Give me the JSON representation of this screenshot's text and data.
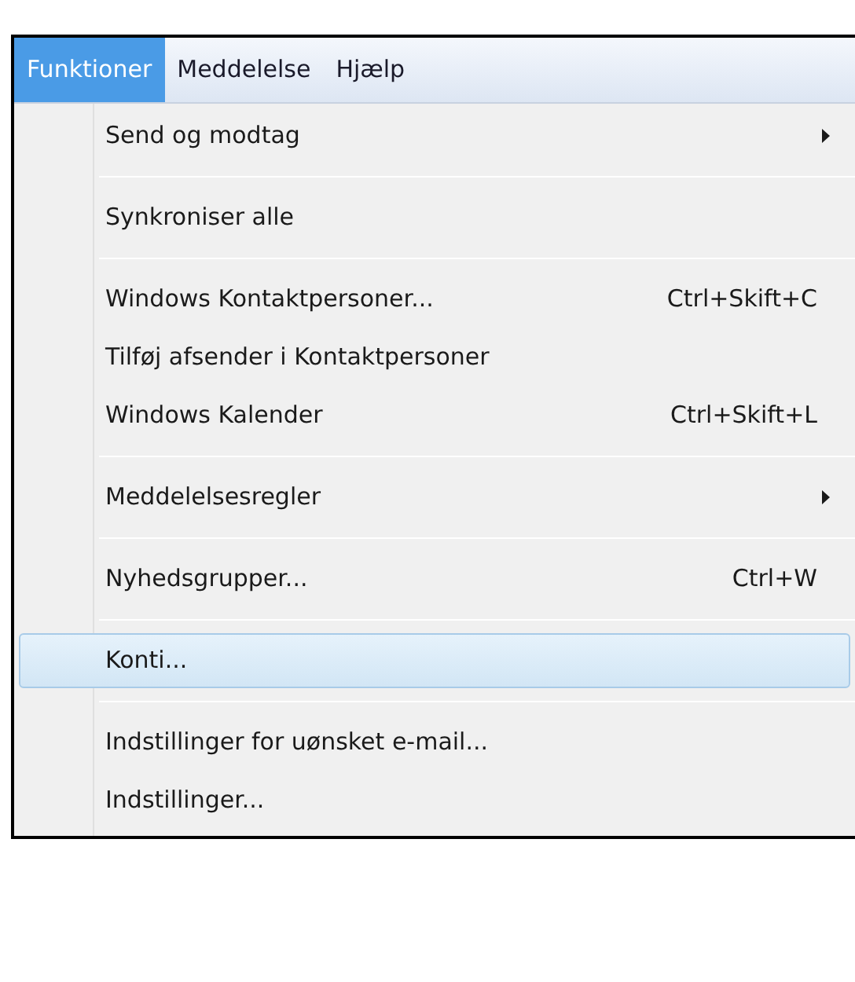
{
  "menubar": [
    {
      "label": "Funktioner",
      "selected": true
    },
    {
      "label": "Meddelelse",
      "selected": false
    },
    {
      "label": "Hjælp",
      "selected": false
    }
  ],
  "menu": [
    {
      "kind": "item",
      "label": "Send og modtag",
      "submenu": true,
      "selected": false
    },
    {
      "kind": "separator"
    },
    {
      "kind": "item",
      "label": "Synkroniser alle",
      "selected": false
    },
    {
      "kind": "separator"
    },
    {
      "kind": "item",
      "label": "Windows Kontaktpersoner...",
      "shortcut": "Ctrl+Skift+C",
      "selected": false
    },
    {
      "kind": "item",
      "label": "Tilføj afsender i Kontaktpersoner",
      "selected": false
    },
    {
      "kind": "item",
      "label": "Windows Kalender",
      "shortcut": "Ctrl+Skift+L",
      "selected": false
    },
    {
      "kind": "separator"
    },
    {
      "kind": "item",
      "label": "Meddelelsesregler",
      "submenu": true,
      "selected": false
    },
    {
      "kind": "separator"
    },
    {
      "kind": "item",
      "label": "Nyhedsgrupper...",
      "shortcut": "Ctrl+W",
      "selected": false
    },
    {
      "kind": "separator"
    },
    {
      "kind": "item",
      "label": "Konti...",
      "selected": true
    },
    {
      "kind": "separator"
    },
    {
      "kind": "item",
      "label": "Indstillinger for uønsket e-mail...",
      "selected": false
    },
    {
      "kind": "item",
      "label": "Indstillinger...",
      "selected": false
    }
  ]
}
